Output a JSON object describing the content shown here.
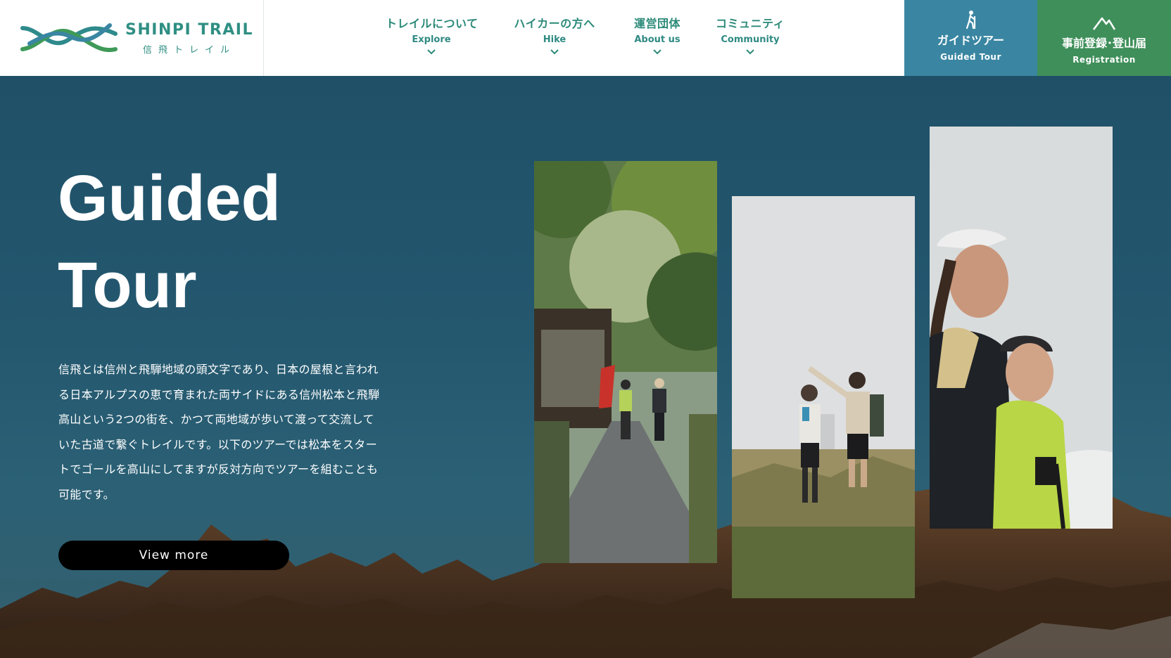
{
  "logo": {
    "name": "SHINPI TRAIL",
    "sub": "信飛トレイル"
  },
  "nav": {
    "items": [
      {
        "jp": "トレイルについて",
        "en": "Explore"
      },
      {
        "jp": "ハイカーの方へ",
        "en": "Hike"
      },
      {
        "jp": "運営団体",
        "en": "About us"
      },
      {
        "jp": "コミュニティ",
        "en": "Community"
      }
    ],
    "icons": [
      "chevron-down-icon"
    ]
  },
  "cta": {
    "guide": {
      "jp": "ガイドツアー",
      "en": "Guided Tour",
      "icon": "hiker-icon",
      "color": "#3a86a2"
    },
    "register": {
      "jp": "事前登録･登山届",
      "en": "Registration",
      "icon": "mountain-icon",
      "color": "#3f8f5a"
    }
  },
  "hero": {
    "title_line1": "Guided",
    "title_line2": "Tour",
    "description": "信飛とは信州と飛騨地域の頭文字であり、日本の屋根と言われる日本アルプスの恵で育まれた両サイドにある信州松本と飛騨高山という2つの街を、かつて両地域が歩いて渡って交流していた古道で繋ぐトレイルです。以下のツアーでは松本をスタートでゴールを高山にしてますが反対方向でツアーを組むことも可能です。",
    "button": "View more"
  },
  "colors": {
    "brand_green": "#2f8f83",
    "hero_bg": "#24556d"
  }
}
